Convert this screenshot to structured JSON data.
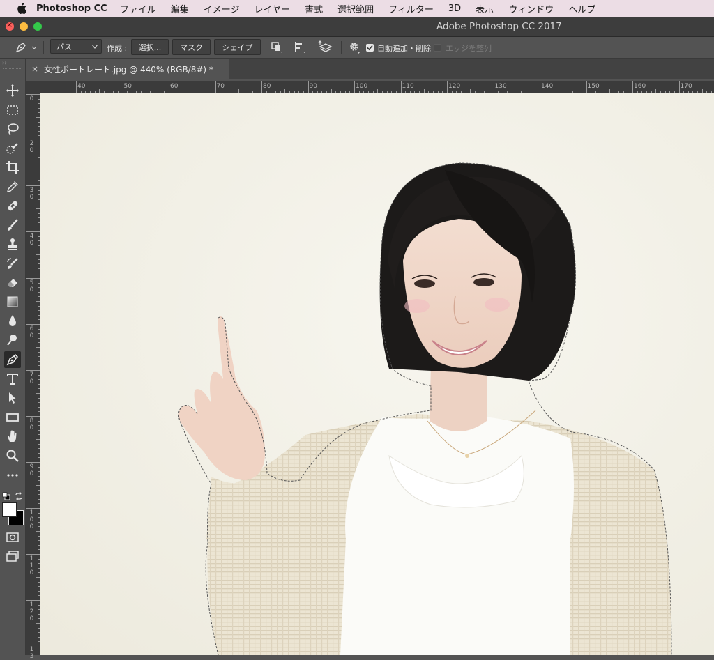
{
  "menubar": {
    "app_name": "Photoshop CC",
    "items": [
      "ファイル",
      "編集",
      "イメージ",
      "レイヤー",
      "書式",
      "選択範囲",
      "フィルター",
      "3D",
      "表示",
      "ウィンドウ",
      "ヘルプ"
    ]
  },
  "window": {
    "title": "Adobe Photoshop CC 2017"
  },
  "options": {
    "tool_preset_icon": "pen-icon",
    "mode_select": "パス",
    "make_label": "作成 :",
    "selection_button": "選択...",
    "mask_button": "マスク",
    "shape_button": "シェイプ",
    "auto_add_delete_label": "自動追加・削除",
    "auto_add_delete_checked": true,
    "align_edges_label": "エッジを整列",
    "align_edges_checked": false
  },
  "document": {
    "tab_title": "女性ポートレート.jpg @ 440% (RGB/8#) *",
    "close_glyph": "×"
  },
  "rulers": {
    "horizontal_labels": [
      "40",
      "50",
      "60",
      "70",
      "80",
      "90",
      "100",
      "110",
      "120",
      "130",
      "140",
      "150",
      "160",
      "170"
    ],
    "vertical_labels": [
      "0",
      "2\n0",
      "3\n0",
      "4\n0",
      "5\n0",
      "6\n0",
      "7\n0",
      "8\n0",
      "9\n0",
      "1\n0\n0",
      "1\n1\n0",
      "1\n2\n0",
      "1\n3"
    ]
  },
  "tools": [
    {
      "name": "move-tool-icon"
    },
    {
      "name": "marquee-tool-icon"
    },
    {
      "name": "lasso-tool-icon"
    },
    {
      "name": "quick-selection-tool-icon"
    },
    {
      "name": "crop-tool-icon"
    },
    {
      "name": "eyedropper-tool-icon"
    },
    {
      "name": "healing-brush-tool-icon"
    },
    {
      "name": "brush-tool-icon"
    },
    {
      "name": "clone-stamp-tool-icon"
    },
    {
      "name": "history-brush-tool-icon"
    },
    {
      "name": "eraser-tool-icon"
    },
    {
      "name": "gradient-tool-icon"
    },
    {
      "name": "blur-tool-icon"
    },
    {
      "name": "dodge-tool-icon"
    },
    {
      "name": "pen-tool-icon"
    },
    {
      "name": "type-tool-icon"
    },
    {
      "name": "path-selection-tool-icon"
    },
    {
      "name": "rectangle-tool-icon"
    },
    {
      "name": "hand-tool-icon"
    },
    {
      "name": "zoom-tool-icon"
    },
    {
      "name": "more-tools-icon"
    }
  ],
  "colors": {
    "foreground": "#ffffff",
    "background": "#000000",
    "canvas_bg": "#f3f1e9"
  }
}
